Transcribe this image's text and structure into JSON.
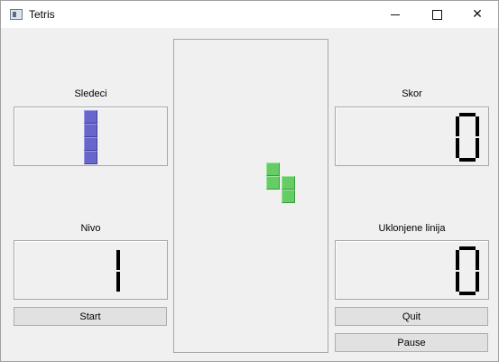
{
  "window": {
    "title": "Tetris",
    "min_icon": "minimize-icon",
    "max_icon": "maximize-icon",
    "close_glyph": "✕"
  },
  "next_panel": {
    "label": "Sledeci",
    "piece": "I",
    "color": "#6666cc"
  },
  "score_panel": {
    "label": "Skor",
    "value": "0"
  },
  "level_panel": {
    "label": "Nivo",
    "value": "1"
  },
  "lines_panel": {
    "label": "Uklonjene linija",
    "value": "0"
  },
  "board": {
    "current_piece": "S",
    "color": "#66cc66"
  },
  "buttons": {
    "start": "Start",
    "quit": "Quit",
    "pause": "Pause"
  }
}
